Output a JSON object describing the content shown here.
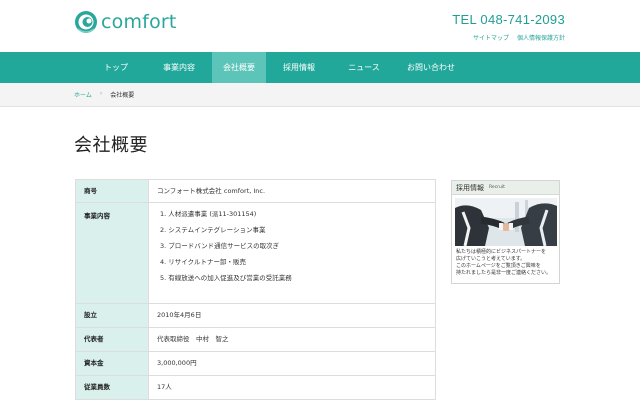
{
  "header": {
    "logo_text": "comfort",
    "tel": "TEL 048-741-2093",
    "links": [
      "サイトマップ",
      "個人情報保護方針"
    ]
  },
  "nav": {
    "items": [
      "トップ",
      "事業内容",
      "会社概要",
      "採用情報",
      "ニュース",
      "お問い合わせ"
    ],
    "active_index": 2
  },
  "breadcrumb": {
    "home": "ホーム",
    "separator": "›",
    "current": "会社概要"
  },
  "page_title": "会社概要",
  "company": {
    "rows": [
      {
        "label": "商号",
        "value": "コンフォート株式会社 comfort, Inc."
      },
      {
        "label": "事業内容",
        "items": [
          "1. 人材派遣事業 (派11-301154)",
          "2. システムインテグレーション事業",
          "3. ブロードバンド通信サービスの取次ぎ",
          "4. リサイクルトナー卸・販売",
          "5. 有線放送への加入促進及び営業の受託業務"
        ]
      },
      {
        "label": "設立",
        "value": "2010年4月6日"
      },
      {
        "label": "代表者",
        "value": "代表取締役　中村　智之"
      },
      {
        "label": "資本金",
        "value": "3,000,000円"
      },
      {
        "label": "従業員数",
        "value": "17人"
      }
    ]
  },
  "recruit_banner": {
    "title": "採用情報",
    "subtitle": "Recruit",
    "text_lines": [
      "私たちは積極的にビジネスパートナーを",
      "広げていこうと考えています。",
      "このホームページをご覧頂きご興味を",
      "持たれましたら是非一度ご連絡ください。"
    ]
  },
  "colors": {
    "brand": "#21a89a",
    "nav_active": "#5cc4b8",
    "table_header_bg": "#daf0ec",
    "breadcrumb_bg": "#f4f4f4"
  }
}
